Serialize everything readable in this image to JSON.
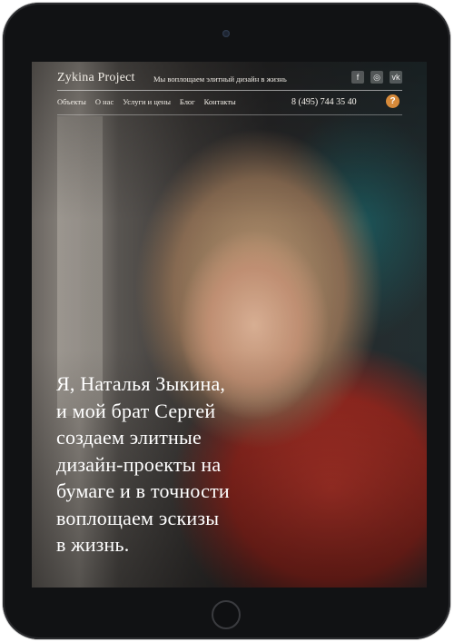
{
  "header": {
    "brand": "Zykina Project",
    "tagline": "Мы воплощаем элитный дизайн в жизнь",
    "socials": [
      {
        "icon": "facebook-icon",
        "glyph": "f"
      },
      {
        "icon": "instagram-icon",
        "glyph": "◎"
      },
      {
        "icon": "vk-icon",
        "glyph": "vk"
      }
    ]
  },
  "nav": {
    "items": [
      "Объекты",
      "О нас",
      "Услуги и цены",
      "Блог",
      "Контакты"
    ],
    "phone": "8 (495) 744 35 40",
    "help": "?"
  },
  "hero": {
    "lines": [
      "Я, Наталья Зыкина,",
      "и мой брат Сергей",
      "создаем элитные",
      "дизайн-проекты на",
      "бумаге и в точности",
      "воплощаем эскизы",
      "в жизнь."
    ]
  }
}
